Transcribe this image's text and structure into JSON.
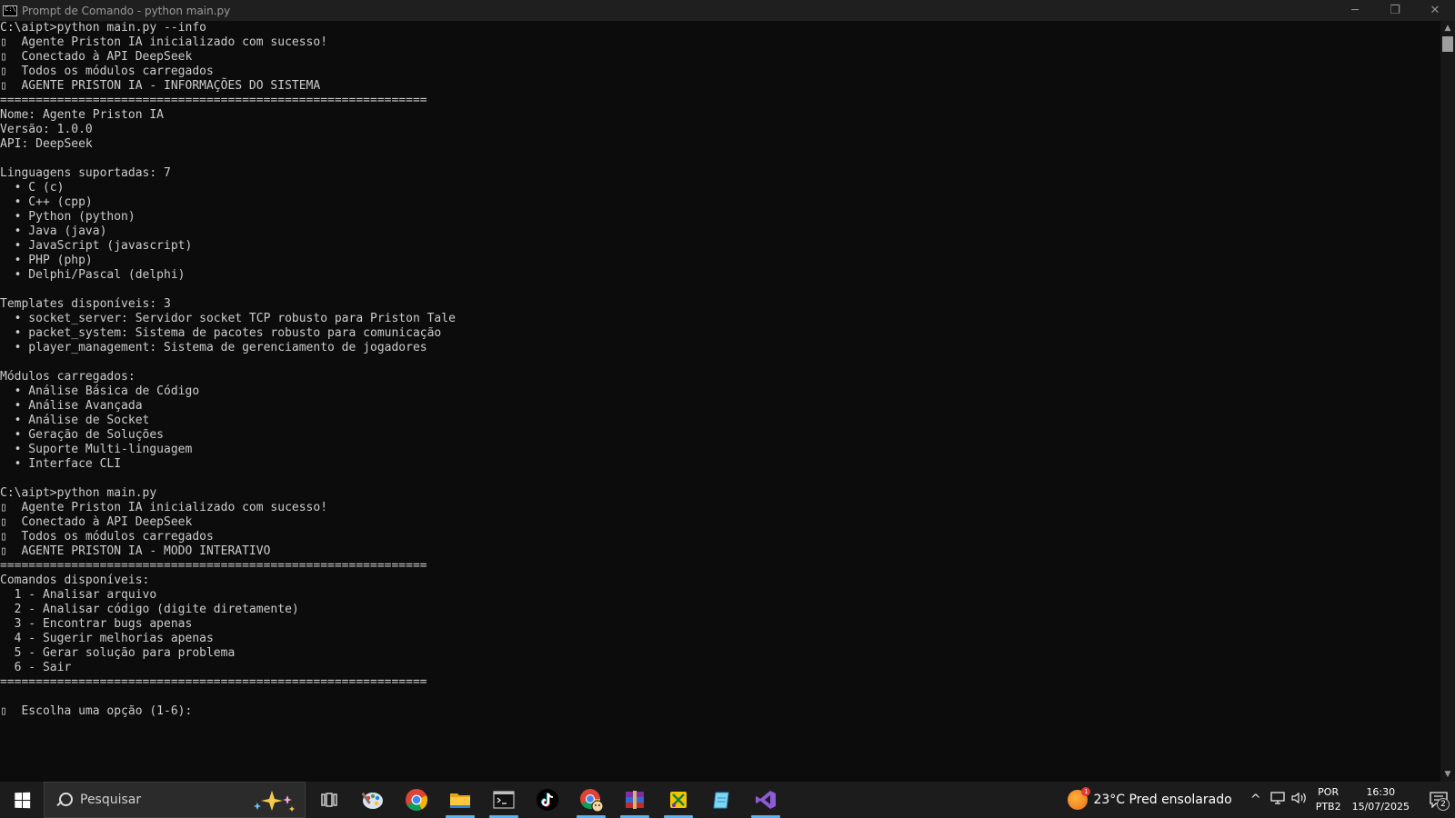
{
  "window": {
    "title": "Prompt de Comando - python  main.py",
    "minimize_glyph": "─",
    "restore_glyph": "❐",
    "close_glyph": "✕"
  },
  "console_lines": [
    "C:\\aipt>python main.py --info",
    "▯  Agente Priston IA inicializado com sucesso!",
    "▯  Conectado à API DeepSeek",
    "▯  Todos os módulos carregados",
    "▯  AGENTE PRISTON IA - INFORMAÇÕES DO SISTEMA",
    "============================================================",
    "Nome: Agente Priston IA",
    "Versão: 1.0.0",
    "API: DeepSeek",
    "",
    "Linguagens suportadas: 7",
    "  • C (c)",
    "  • C++ (cpp)",
    "  • Python (python)",
    "  • Java (java)",
    "  • JavaScript (javascript)",
    "  • PHP (php)",
    "  • Delphi/Pascal (delphi)",
    "",
    "Templates disponíveis: 3",
    "  • socket_server: Servidor socket TCP robusto para Priston Tale",
    "  • packet_system: Sistema de pacotes robusto para comunicação",
    "  • player_management: Sistema de gerenciamento de jogadores",
    "",
    "Módulos carregados:",
    "  • Análise Básica de Código",
    "  • Análise Avançada",
    "  • Análise de Socket",
    "  • Geração de Soluções",
    "  • Suporte Multi-linguagem",
    "  • Interface CLI",
    "",
    "C:\\aipt>python main.py",
    "▯  Agente Priston IA inicializado com sucesso!",
    "▯  Conectado à API DeepSeek",
    "▯  Todos os módulos carregados",
    "▯  AGENTE PRISTON IA - MODO INTERATIVO",
    "============================================================",
    "Comandos disponíveis:",
    "  1 - Analisar arquivo",
    "  2 - Analisar código (digite diretamente)",
    "  3 - Encontrar bugs apenas",
    "  4 - Sugerir melhorias apenas",
    "  5 - Gerar solução para problema",
    "  6 - Sair",
    "============================================================",
    "",
    "▯  Escolha uma opção (1-6): "
  ],
  "scrollbar": {
    "up_glyph": "▲",
    "down_glyph": "▼"
  },
  "taskbar": {
    "search_placeholder": "Pesquisar",
    "weather_badge": "1",
    "weather_text": "23°C  Pred ensolarado",
    "tray_chevron": "^",
    "language_line1": "POR",
    "language_line2": "PTB2",
    "time": "16:30",
    "date": "15/07/2025",
    "notification_count": "2"
  },
  "colors": {
    "console_bg": "#0c0c0c",
    "console_text": "#cccccc",
    "titlebar_bg": "#1f1f1f",
    "taskbar_bg": "#1c1c1c",
    "active_indicator": "#5bb4f0"
  }
}
